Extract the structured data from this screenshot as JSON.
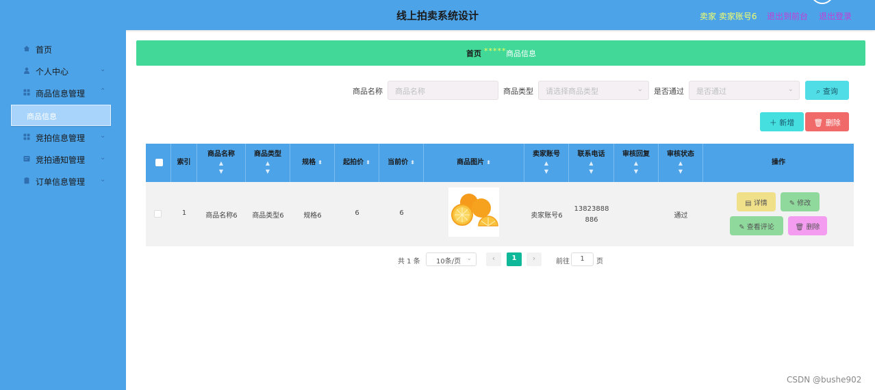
{
  "header": {
    "title": "线上拍卖系统设计",
    "user": "卖家 卖家账号6",
    "back_label": "退出到前台",
    "logout_label": "退出登录"
  },
  "sidebar": {
    "items": [
      {
        "label": "首页",
        "icon": "home-icon"
      },
      {
        "label": "个人中心",
        "icon": "user-icon"
      },
      {
        "label": "商品信息管理",
        "icon": "grid-icon"
      },
      {
        "label": "竞拍信息管理",
        "icon": "grid-icon"
      },
      {
        "label": "竞拍通知管理",
        "icon": "doc-icon"
      },
      {
        "label": "订单信息管理",
        "icon": "clipboard-icon"
      }
    ],
    "sub_item": "商品信息"
  },
  "breadcrumb": {
    "home": "首页",
    "separator": "*****",
    "current": "商品信息"
  },
  "search": {
    "name_label": "商品名称",
    "name_placeholder": "商品名称",
    "type_label": "商品类型",
    "type_placeholder": "请选择商品类型",
    "approved_label": "是否通过",
    "approved_placeholder": "是否通过",
    "search_button": "查询"
  },
  "actions": {
    "add_button": "新增",
    "delete_button": "删除"
  },
  "table": {
    "headers": [
      "索引",
      "商品名称",
      "商品类型",
      "规格",
      "起拍价",
      "当前价",
      "商品图片",
      "卖家账号",
      "联系电话",
      "审核回复",
      "审核状态",
      "操作"
    ],
    "rows": [
      {
        "index": "1",
        "name": "商品名称6",
        "type": "商品类型6",
        "spec": "规格6",
        "start_price": "6",
        "current_price": "6",
        "seller": "卖家账号6",
        "phone_line1": "13823888",
        "phone_line2": "886",
        "reply": "",
        "status": "通过",
        "btn_detail": "详情",
        "btn_edit": "修改",
        "btn_comments": "查看评论",
        "btn_delete": "删除"
      }
    ]
  },
  "pagination": {
    "total": "共 1 条",
    "page_size": "10条/页",
    "current_page": "1",
    "goto_label": "前往",
    "goto_value": "1",
    "page_unit": "页"
  },
  "watermark": "CSDN @bushe902",
  "colors": {
    "header": "#4da3e8",
    "breadcrumb": "#41d898",
    "search_btn": "#50dde5",
    "delete_btn": "#f06a6a",
    "detail_btn": "#f0e08a",
    "edit_btn": "#8fd99c",
    "row_delete_btn": "#f39cf0",
    "page_active": "#10b89a"
  }
}
